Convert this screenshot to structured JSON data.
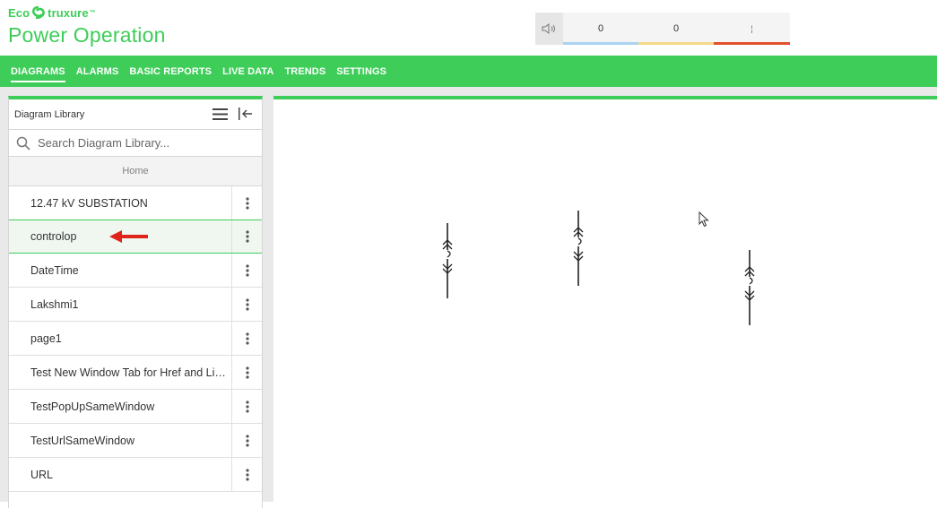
{
  "brand": {
    "eco_prefix": "Eco",
    "eco_suffix": "truxure",
    "trademark": "™",
    "product": "Power Operation",
    "color": "#3dcd58"
  },
  "alarm_bar": {
    "mute_icon": "speaker-icon",
    "segments": [
      {
        "value": "0",
        "color": "#a9d3f2"
      },
      {
        "value": "0",
        "color": "#f4d98a"
      },
      {
        "value": "¦",
        "color": "#e2502d"
      }
    ]
  },
  "nav": {
    "items": [
      {
        "label": "DIAGRAMS",
        "active": true
      },
      {
        "label": "ALARMS",
        "active": false
      },
      {
        "label": "BASIC REPORTS",
        "active": false
      },
      {
        "label": "LIVE DATA",
        "active": false
      },
      {
        "label": "TRENDS",
        "active": false
      },
      {
        "label": "SETTINGS",
        "active": false
      }
    ]
  },
  "sidebar": {
    "title": "Diagram Library",
    "menu_icon": "hamburger-icon",
    "collapse_icon": "collapse-left-icon",
    "search": {
      "placeholder": "Search Diagram Library...",
      "value": "",
      "icon": "search-icon"
    },
    "home_label": "Home",
    "items": [
      {
        "label": "12.47 kV SUBSTATION",
        "selected": false
      },
      {
        "label": "controlop",
        "selected": true
      },
      {
        "label": "DateTime",
        "selected": false
      },
      {
        "label": "Lakshmi1",
        "selected": false
      },
      {
        "label": "page1",
        "selected": false
      },
      {
        "label": "Test New Window Tab for Href and Links",
        "selected": false
      },
      {
        "label": "TestPopUpSameWindow",
        "selected": false
      },
      {
        "label": "TestUrlSameWindow",
        "selected": false
      },
      {
        "label": "URL",
        "selected": false
      }
    ],
    "more_icon": "vertical-ellipsis-icon",
    "annotation_arrow_color": "#e0241b"
  },
  "canvas": {
    "devices": [
      "breaker-symbol",
      "breaker-symbol",
      "breaker-symbol"
    ]
  }
}
